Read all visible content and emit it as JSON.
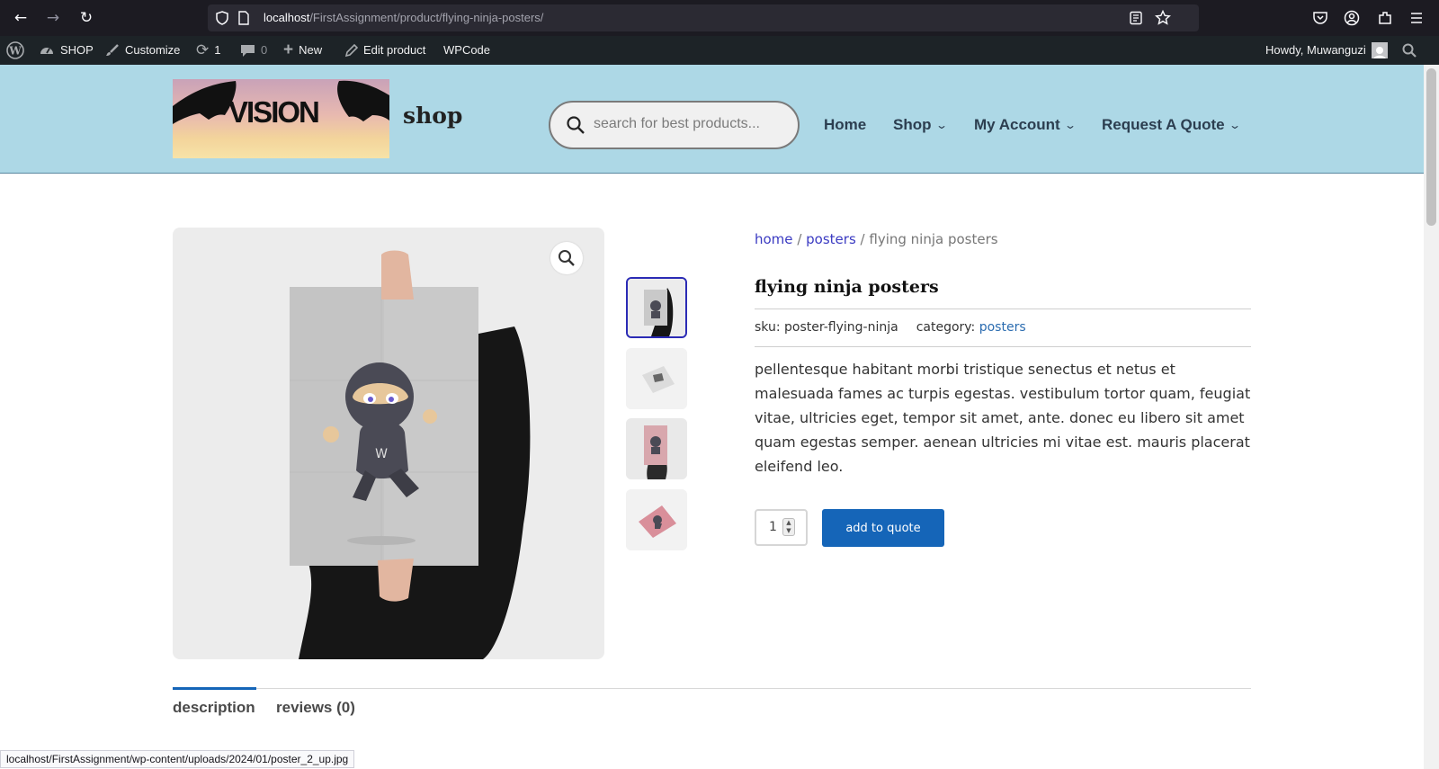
{
  "browser": {
    "url_host": "localhost",
    "url_path": "/FirstAssignment/product/flying-ninja-posters/"
  },
  "adminbar": {
    "site": "SHOP",
    "customize": "Customize",
    "updates": "1",
    "comments": "0",
    "new": "New",
    "edit": "Edit product",
    "wpcode": "WPCode",
    "howdy": "Howdy, Muwanguzi"
  },
  "header": {
    "logo_text": "VISION",
    "site_title": "shop",
    "search_placeholder": "search for best products...",
    "menu": [
      {
        "label": "Home"
      },
      {
        "label": "Shop"
      },
      {
        "label": "My Account"
      },
      {
        "label": "Request A Quote"
      }
    ]
  },
  "product": {
    "breadcrumb": {
      "home": "home",
      "sep": "/",
      "category": "posters",
      "current": "flying ninja posters"
    },
    "title": "flying ninja posters",
    "sku_label": "sku:",
    "sku": "poster-flying-ninja",
    "category_label": "category:",
    "category": "posters",
    "description": "pellentesque habitant morbi tristique senectus et netus et malesuada fames ac turpis egestas. vestibulum tortor quam, feugiat vitae, ultricies eget, tempor sit amet, ante. donec eu libero sit amet quam egestas semper. aenean ultricies mi vitae est. mauris placerat eleifend leo.",
    "quantity": "1",
    "add_button": "add to quote"
  },
  "tabs": [
    {
      "label": "description"
    },
    {
      "label": "reviews (0)"
    }
  ],
  "status_bar": "localhost/FirstAssignment/wp-content/uploads/2024/01/poster_2_up.jpg",
  "colors": {
    "header_bg": "#add8e6",
    "primary_button": "#1565b8",
    "link": "#3b3bc2",
    "adminbar_bg": "#1d2327"
  }
}
